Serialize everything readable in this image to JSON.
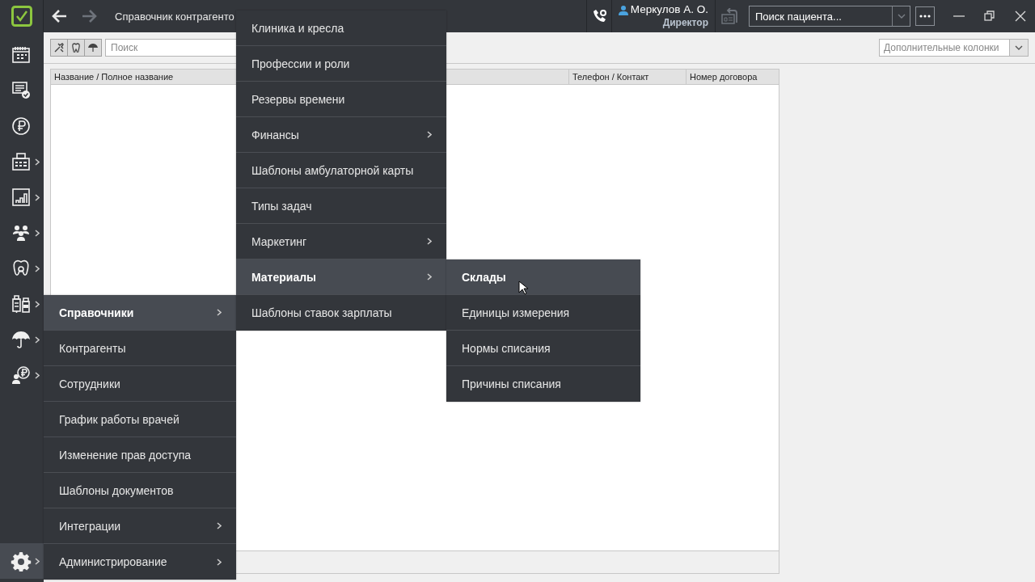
{
  "top_bar": {
    "title": "Справочник контрагенто",
    "forward_disabled": true,
    "user": {
      "name": "Меркулов А. О.",
      "role": "Директор"
    },
    "patient_search": {
      "placeholder": "Поиск пациента..."
    }
  },
  "sidebar": {
    "items": [
      {
        "has_submenu": false,
        "selected": false
      },
      {
        "has_submenu": false,
        "selected": false
      },
      {
        "has_submenu": false,
        "selected": false
      },
      {
        "has_submenu": true,
        "selected": false
      },
      {
        "has_submenu": true,
        "selected": false
      },
      {
        "has_submenu": true,
        "selected": false
      },
      {
        "has_submenu": true,
        "selected": false
      },
      {
        "has_submenu": true,
        "selected": false
      },
      {
        "has_submenu": true,
        "selected": false
      },
      {
        "has_submenu": true,
        "selected": false
      },
      {
        "has_submenu": true,
        "selected": true
      }
    ]
  },
  "toolbar": {
    "search": {
      "placeholder": "Поиск"
    },
    "columns_dropdown": {
      "placeholder": "Дополнительные колонки"
    }
  },
  "table": {
    "columns": [
      "Название / Полное название",
      "Телефон / Контакт",
      "Номер договора"
    ]
  },
  "menus": [
    {
      "items": [
        {
          "label": "Справочники",
          "has_submenu": true,
          "selected": true
        },
        {
          "label": "Контрагенты",
          "has_submenu": false,
          "selected": false
        },
        {
          "label": "Сотрудники",
          "has_submenu": false,
          "selected": false
        },
        {
          "label": "График работы врачей",
          "has_submenu": false,
          "selected": false
        },
        {
          "label": "Изменение прав доступа",
          "has_submenu": false,
          "selected": false
        },
        {
          "label": "Шаблоны документов",
          "has_submenu": false,
          "selected": false
        },
        {
          "label": "Интеграции",
          "has_submenu": true,
          "selected": false
        },
        {
          "label": "Администрирование",
          "has_submenu": true,
          "selected": false
        }
      ]
    },
    {
      "items": [
        {
          "label": "Клиника и кресла",
          "has_submenu": false,
          "selected": false
        },
        {
          "label": "Профессии и роли",
          "has_submenu": false,
          "selected": false
        },
        {
          "label": "Резервы времени",
          "has_submenu": false,
          "selected": false
        },
        {
          "label": "Финансы",
          "has_submenu": true,
          "selected": false
        },
        {
          "label": "Шаблоны амбулаторной карты",
          "has_submenu": false,
          "selected": false
        },
        {
          "label": "Типы задач",
          "has_submenu": false,
          "selected": false
        },
        {
          "label": "Маркетинг",
          "has_submenu": true,
          "selected": false
        },
        {
          "label": "Материалы",
          "has_submenu": true,
          "selected": true
        },
        {
          "label": "Шаблоны ставок зарплаты",
          "has_submenu": false,
          "selected": false
        }
      ]
    },
    {
      "items": [
        {
          "label": "Склады",
          "has_submenu": false,
          "selected": true
        },
        {
          "label": "Единицы измерения",
          "has_submenu": false,
          "selected": false
        },
        {
          "label": "Нормы списания",
          "has_submenu": false,
          "selected": false
        },
        {
          "label": "Причины списания",
          "has_submenu": false,
          "selected": false
        }
      ]
    }
  ]
}
